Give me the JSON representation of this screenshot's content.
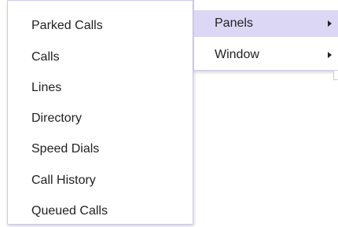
{
  "submenu": {
    "items": [
      {
        "label": "Parked Calls"
      },
      {
        "label": "Calls"
      },
      {
        "label": "Lines"
      },
      {
        "label": "Directory"
      },
      {
        "label": "Speed Dials"
      },
      {
        "label": "Call History"
      },
      {
        "label": "Queued Calls"
      }
    ]
  },
  "menu": {
    "items": [
      {
        "label": "Panels",
        "has_submenu": true,
        "active": true
      },
      {
        "label": "Window",
        "has_submenu": true,
        "active": false
      }
    ]
  },
  "colors": {
    "highlight": "#ddd7f6",
    "border": "#d2c8ec",
    "text": "#222222"
  },
  "icons": {
    "submenu_arrow": "chevron-right-icon"
  }
}
